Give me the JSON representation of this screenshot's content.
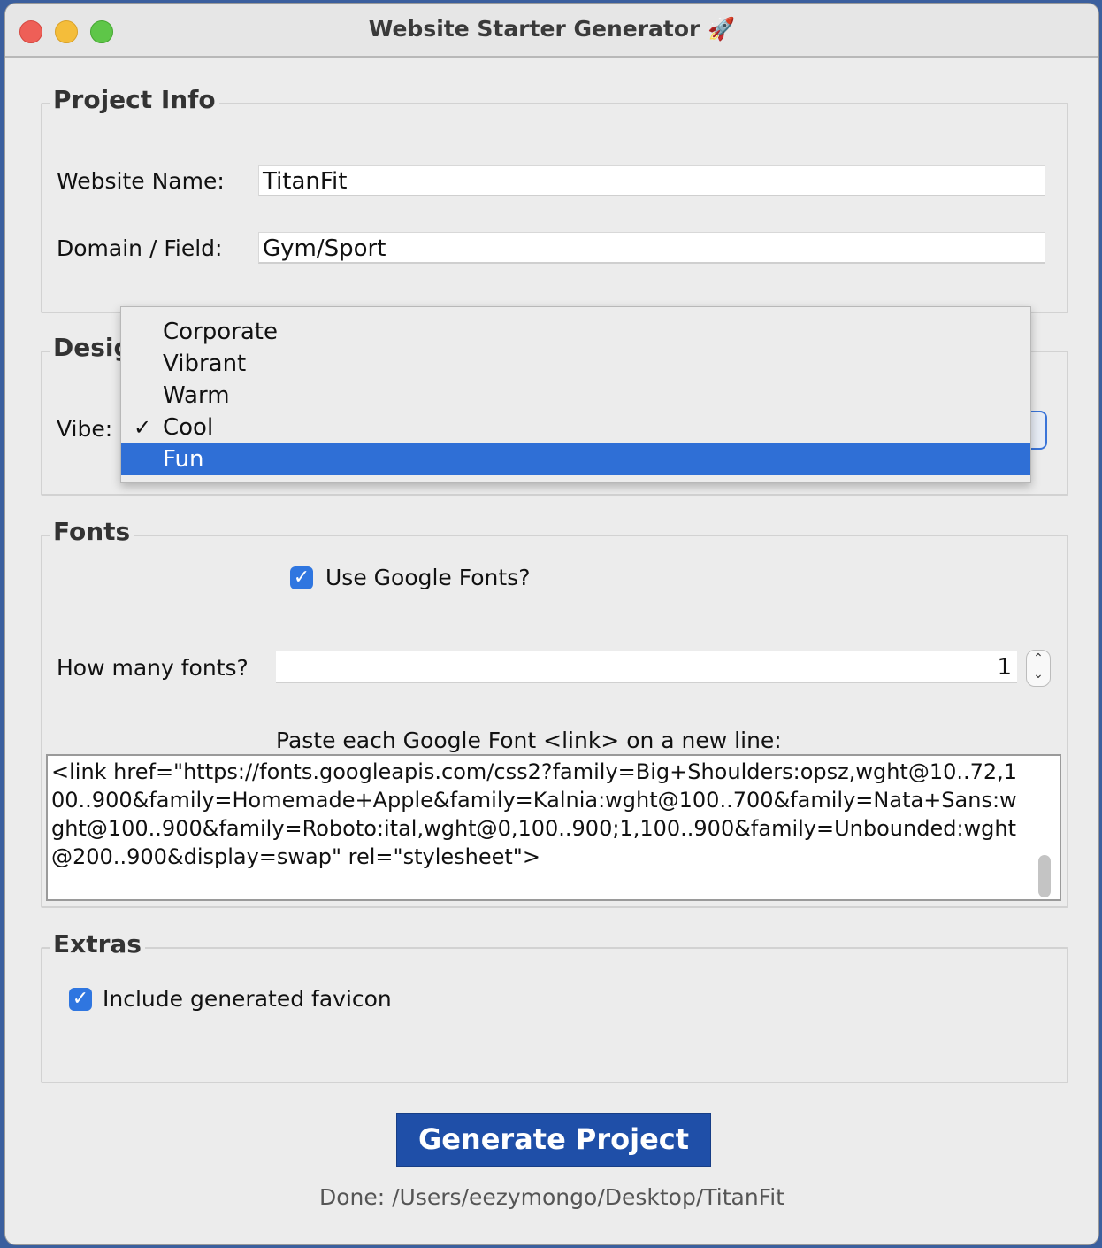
{
  "window": {
    "title": "Website Starter Generator 🚀"
  },
  "project_info": {
    "legend": "Project Info",
    "website_name_label": "Website Name:",
    "website_name_value": "TitanFit",
    "domain_label": "Domain / Field:",
    "domain_value": "Gym/Sport"
  },
  "design": {
    "legend": "Desig",
    "vibe_label": "Vibe:",
    "vibe_options": [
      "Corporate",
      "Vibrant",
      "Warm",
      "Cool",
      "Fun"
    ],
    "checked_option": "Cool",
    "highlighted_option": "Fun",
    "check_glyph": "✓"
  },
  "fonts": {
    "legend": "Fonts",
    "use_google_fonts_label": "Use Google Fonts?",
    "use_google_fonts_checked": true,
    "how_many_label": "How many fonts?",
    "how_many_value": "1",
    "paste_label": "Paste each Google Font <link> on a new line:",
    "links_text": "<link href=\"https://fonts.googleapis.com/css2?family=Big+Shoulders:opsz,wght@10..72,100..900&family=Homemade+Apple&family=Kalnia:wght@100..700&family=Nata+Sans:wght@100..900&family=Roboto:ital,wght@0,100..900;1,100..900&family=Unbounded:wght@200..900&display=swap\" rel=\"stylesheet\">"
  },
  "extras": {
    "legend": "Extras",
    "favicon_label": "Include generated favicon",
    "favicon_checked": true
  },
  "generate_button_label": "Generate Project",
  "status_text": "Done:  /Users/eezymongo/Desktop/TitanFit",
  "colors": {
    "accent": "#2f6fd6",
    "button": "#1f4fa8"
  }
}
